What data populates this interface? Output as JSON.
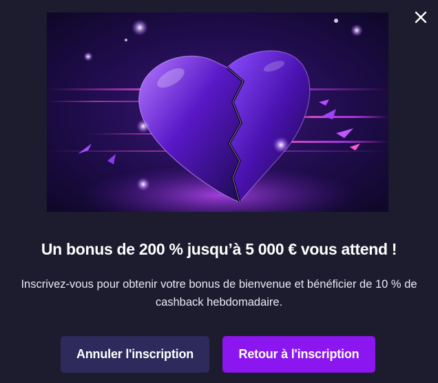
{
  "modal": {
    "close_icon": "close-icon",
    "hero_image": "broken-heart-illustration",
    "title": "Un bonus de 200 % jusqu’à 5 000 € vous attend !",
    "description": "Inscrivez-vous pour obtenir votre bonus de bienvenue et bénéficier de 10 % de cashback hebdomadaire.",
    "cancel_button": "Annuler l'inscription",
    "return_button": "Retour à l'inscription"
  },
  "colors": {
    "background": "#1d1b2e",
    "cancel_button": "#2e2a5c",
    "return_button": "#8b16f0",
    "accent_purple": "#7a2cff",
    "accent_pink": "#ff3fd0"
  }
}
